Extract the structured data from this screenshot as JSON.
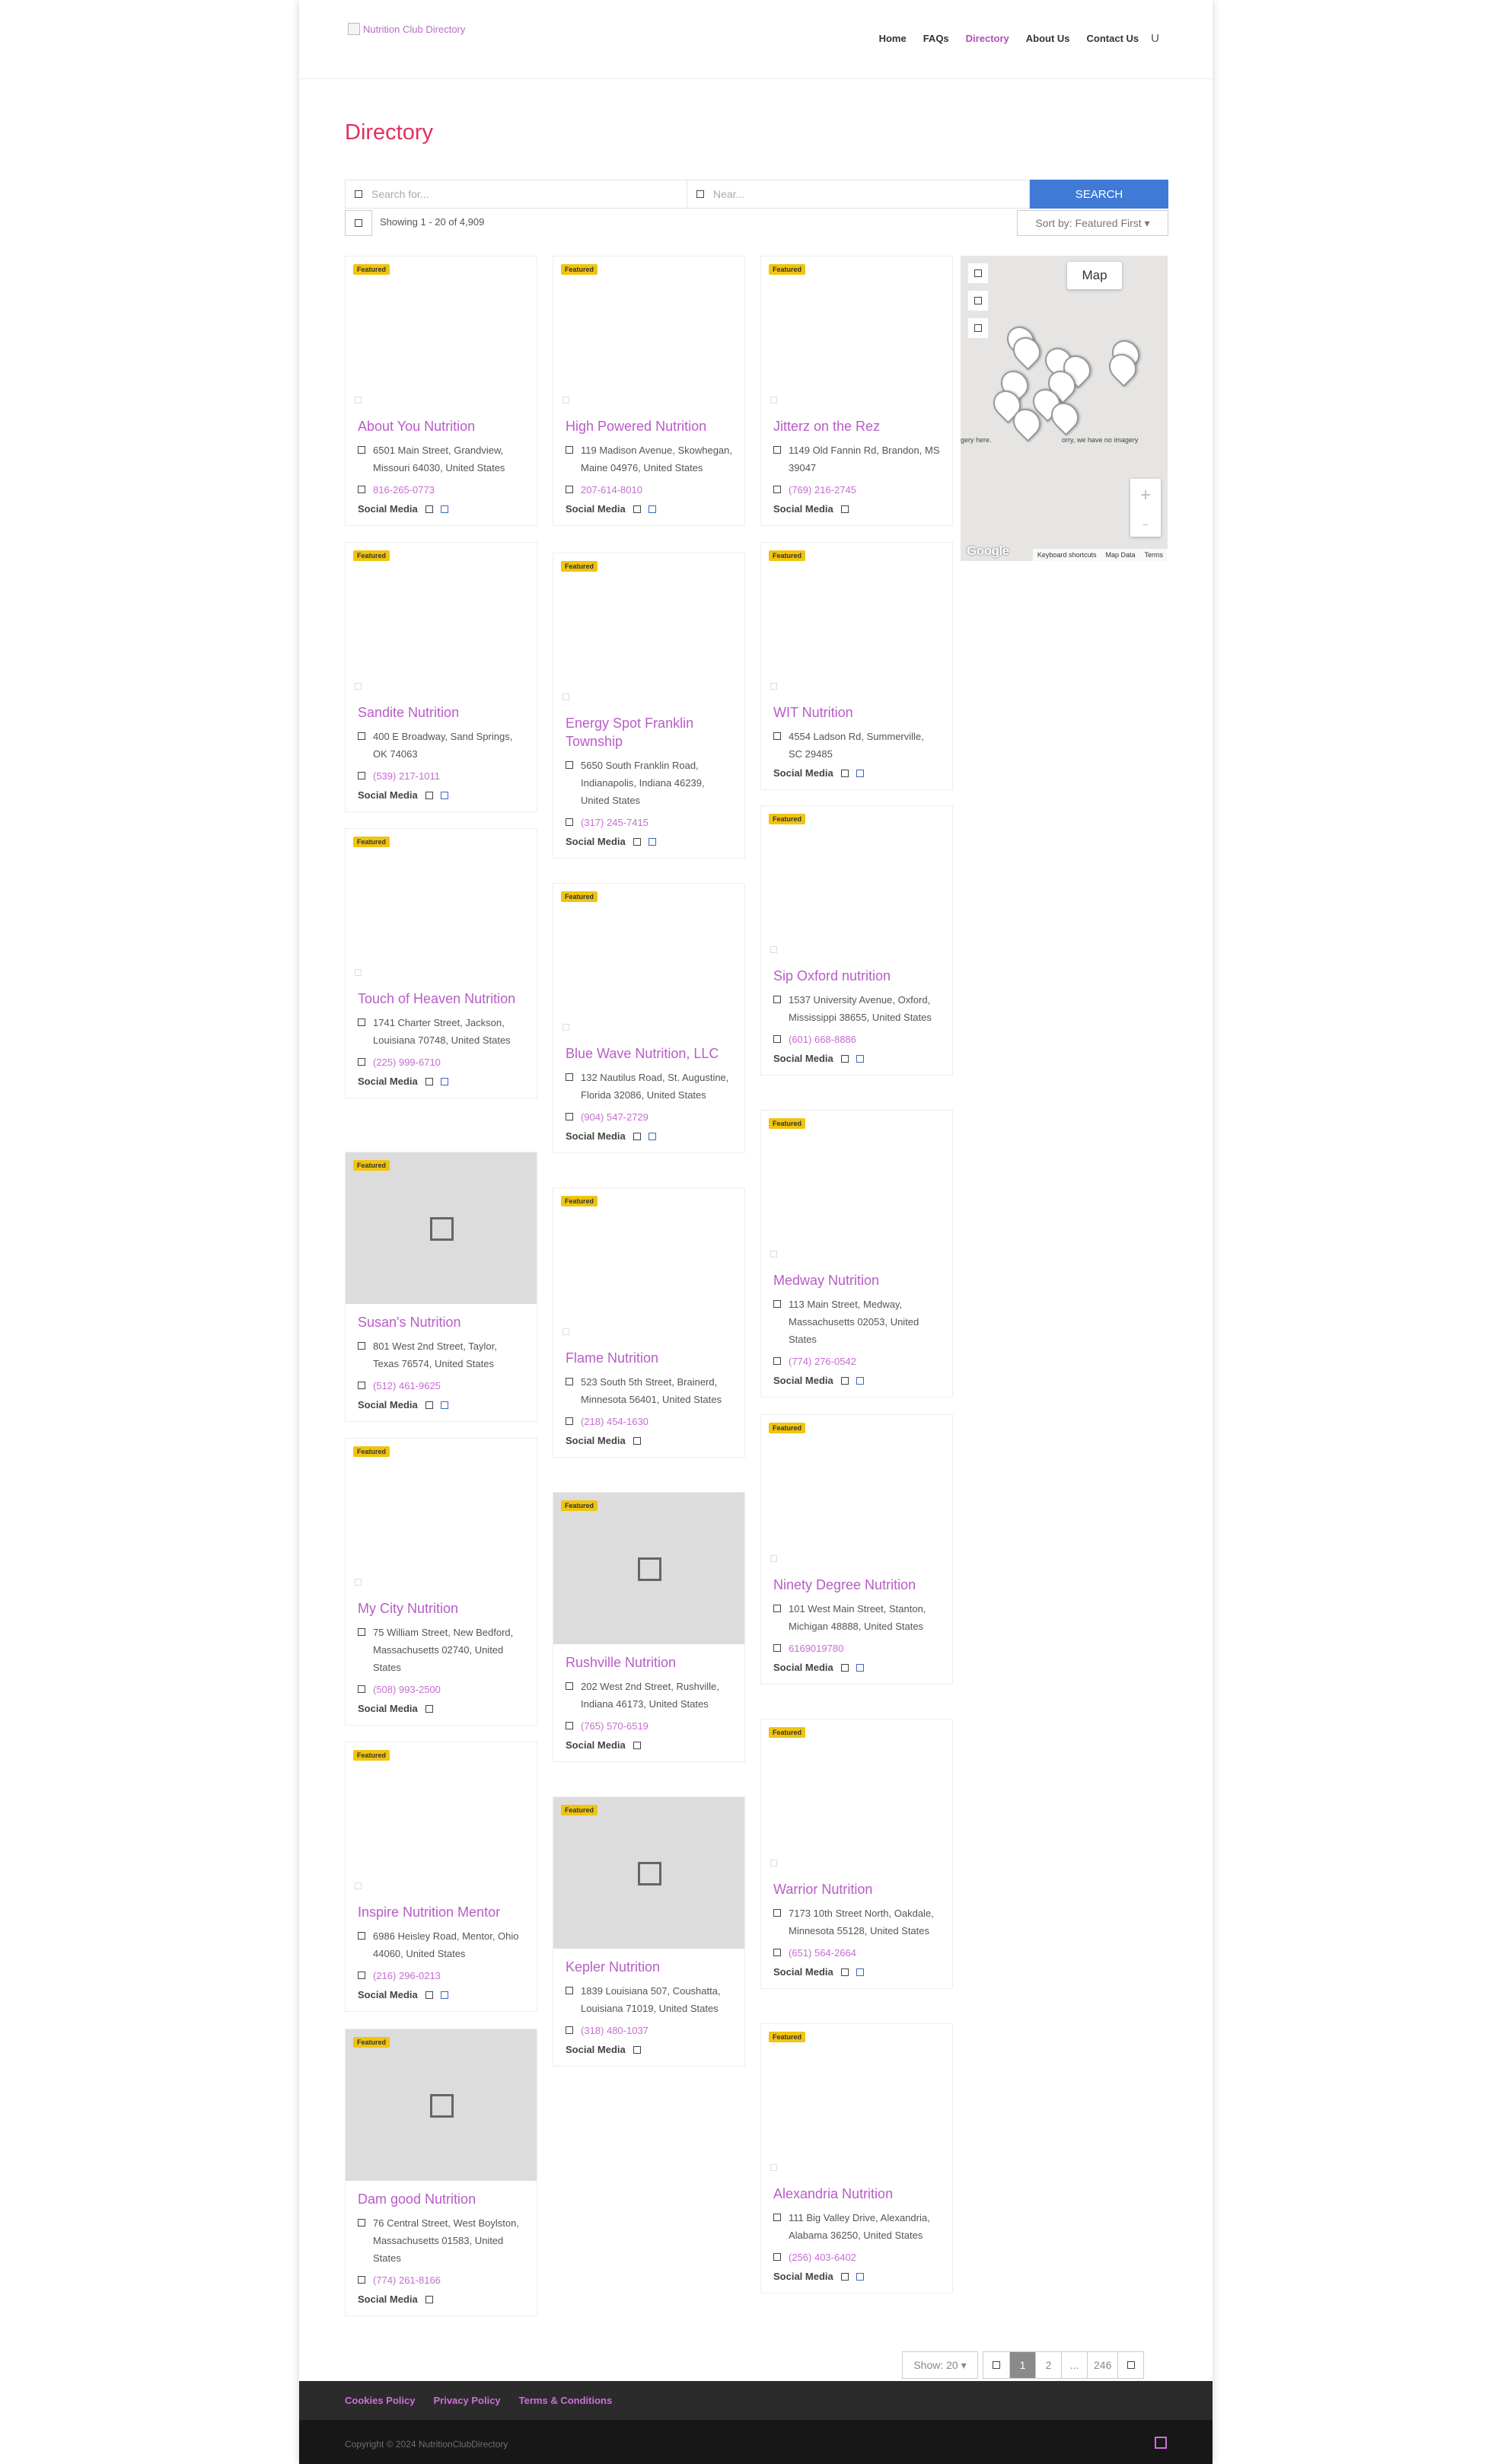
{
  "header": {
    "logo_alt": "Nutrition Club Directory",
    "nav": [
      "Home",
      "FAQs",
      "Directory",
      "About Us",
      "Contact Us"
    ],
    "active_nav": "Directory",
    "search_glyph": "U"
  },
  "page_title": "Directory",
  "search": {
    "keyword_placeholder": "Search for...",
    "location_placeholder": "Near...",
    "button_label": "SEARCH"
  },
  "results": {
    "count_text": "Showing 1 - 20 of 4,909",
    "sort_label": "Sort by: Featured First"
  },
  "badge_label": "Featured",
  "social_label": "Social Media",
  "listings": [
    {
      "name": "About You Nutrition",
      "address": "6501 Main Street, Grandview, Missouri 64030, United States",
      "phone": "816-265-0773",
      "social_icons": 2
    },
    {
      "name": "High Powered Nutrition",
      "address": "119 Madison Avenue, Skowhegan, Maine 04976, United States",
      "phone": "207-614-8010",
      "social_icons": 2
    },
    {
      "name": "Jitterz on the Rez",
      "address": "1149 Old Fannin Rd, Brandon, MS 39047",
      "phone": "(769) 216-2745",
      "social_icons": 1
    },
    {
      "name": "Sandite Nutrition",
      "address": "400 E Broadway, Sand Springs, OK 74063",
      "phone": "(539) 217-1011",
      "social_icons": 2
    },
    {
      "name": "Energy Spot Franklin Township",
      "address": "5650 South Franklin Road, Indianapolis, Indiana 46239, United States",
      "phone": "(317) 245-7415",
      "social_icons": 2
    },
    {
      "name": "WIT Nutrition",
      "address": "4554 Ladson Rd, Summerville, SC 29485",
      "phone": "",
      "social_icons": 2
    },
    {
      "name": "Sip Oxford nutrition",
      "address": "1537 University Avenue, Oxford, Mississippi 38655, United States",
      "phone": "(601) 668-8886",
      "social_icons": 2
    },
    {
      "name": "Touch of Heaven Nutrition",
      "address": "1741 Charter Street, Jackson, Louisiana 70748, United States",
      "phone": "(225) 999-6710",
      "social_icons": 2
    },
    {
      "name": "Blue Wave Nutrition, LLC",
      "address": "132 Nautilus Road, St. Augustine, Florida 32086, United States",
      "phone": "(904) 547-2729",
      "social_icons": 2
    },
    {
      "name": "Medway Nutrition",
      "address": "113 Main Street, Medway, Massachusetts 02053, United States",
      "phone": "(774) 276-0542",
      "social_icons": 2
    },
    {
      "name": "Susan's Nutrition",
      "address": "801 West 2nd Street, Taylor, Texas 76574, United States",
      "phone": "(512) 461-9625",
      "social_icons": 2
    },
    {
      "name": "Flame Nutrition",
      "address": "523 South 5th Street, Brainerd, Minnesota 56401, United States",
      "phone": "(218) 454-1630",
      "social_icons": 1
    },
    {
      "name": "Ninety Degree Nutrition",
      "address": "101 West Main Street, Stanton, Michigan 48888, United States",
      "phone": "6169019780",
      "social_icons": 2
    },
    {
      "name": "My City Nutrition",
      "address": "75 William Street, New Bedford, Massachusetts 02740, United States",
      "phone": "(508) 993-2500",
      "social_icons": 1
    },
    {
      "name": "Rushville Nutrition",
      "address": "202 West 2nd Street, Rushville, Indiana 46173, United States",
      "phone": "(765) 570-6519",
      "social_icons": 1
    },
    {
      "name": "Warrior Nutrition",
      "address": "7173 10th Street North, Oakdale, Minnesota 55128, United States",
      "phone": "(651) 564-2664",
      "social_icons": 2
    },
    {
      "name": "Inspire Nutrition Mentor",
      "address": "6986 Heisley Road, Mentor, Ohio 44060, United States",
      "phone": "(216) 296-0213",
      "social_icons": 2
    },
    {
      "name": "Kepler Nutrition",
      "address": "1839 Louisiana 507, Coushatta, Louisiana 71019, United States",
      "phone": "(318) 480-1037",
      "social_icons": 1
    },
    {
      "name": "Dam good Nutrition",
      "address": "76 Central Street, West Boylston, Massachusetts 01583, United States",
      "phone": "(774) 261-8166",
      "social_icons": 1
    },
    {
      "name": "Alexandria Nutrition",
      "address": "111 Big Valley Drive, Alexandria, Alabama 36250, United States",
      "phone": "(256) 403-6402",
      "social_icons": 2
    }
  ],
  "map": {
    "map_type_label": "Map",
    "no_imagery_left": "gery here.",
    "no_imagery_right": "orry, we have no imagery",
    "google_label": "Google",
    "footer_links": [
      "Keyboard shortcuts",
      "Map Data",
      "Terms"
    ],
    "marker_count": 12
  },
  "pagination": {
    "show_label": "Show: 20",
    "pages": [
      "1",
      "2",
      "...",
      "246"
    ],
    "current_page": "1"
  },
  "footer": {
    "links": [
      "Cookies Policy",
      "Privacy Policy",
      "Terms & Conditions"
    ],
    "copyright": "Copyright © 2024 NutritionClubDirectory"
  },
  "colors": {
    "accent_title": "#e0305e",
    "listing_link": "#b85cc7",
    "search_button": "#3e7ad6",
    "featured_badge": "#f1c40f",
    "footer_link": "#cf6fdc"
  }
}
